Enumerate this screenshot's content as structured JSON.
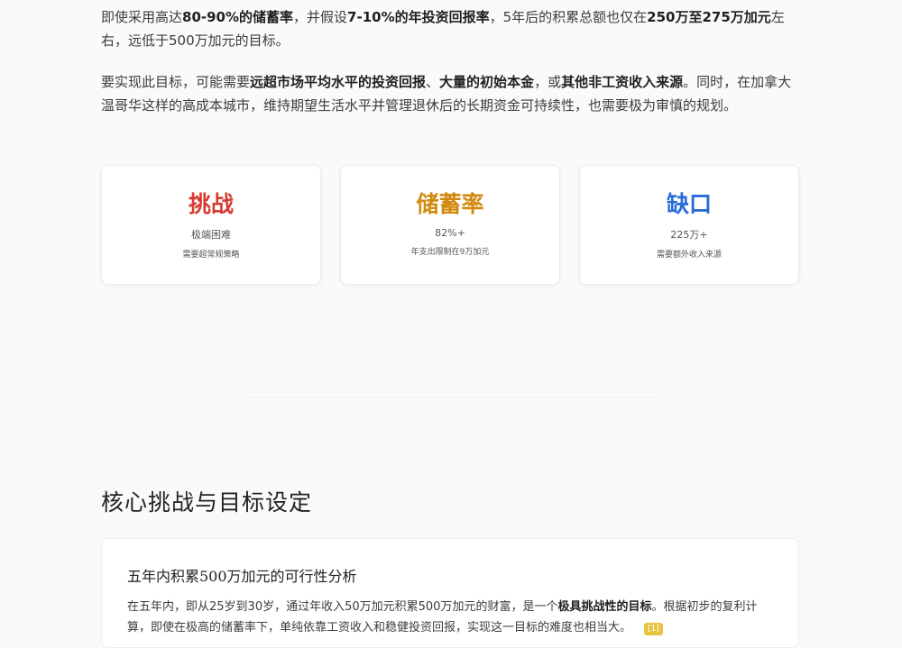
{
  "intro": {
    "p1": {
      "t1": "即使采用高达",
      "b1": "80-90%的储蓄率",
      "t2": "，并假设",
      "b2": "7-10%的年投资回报率",
      "t3": "，5年后的积累总额也仅在",
      "b3": "250万至275万加元",
      "t4": "左右，远低于500万加元的目标。"
    },
    "p2": {
      "t1": "要实现此目标，可能需要",
      "b1": "远超市场平均水平的投资回报",
      "t2": "、",
      "b2": "大量的初始本金",
      "t3": "，或",
      "b3": "其他非工资收入来源",
      "t4": "。同时，在加拿大温哥华这样的高成本城市，维持期望生活水平并管理退休后的长期资金可持续性，也需要极为审慎的规划。"
    }
  },
  "cards": [
    {
      "title": "挑战",
      "sub": "极端困难",
      "note": "需要超常规策略",
      "color": "#d63b30"
    },
    {
      "title": "储蓄率",
      "sub": "82%+",
      "note": "年支出限制在9万加元",
      "color": "#d18a0f"
    },
    {
      "title": "缺口",
      "sub": "225万+",
      "note": "需要额外收入来源",
      "color": "#2a6bd6"
    }
  ],
  "section": {
    "title": "核心挑战与目标设定",
    "panel_title": "五年内积累500万加元的可行性分析",
    "text": {
      "t1": "在五年内，即从25岁到30岁，通过年收入50万加元积累500万加元的财富，是一个",
      "b1": "极具挑战性的目标",
      "t2": "。根据初步的复利计算，即使在极高的储蓄率下，单纯依靠工资收入和稳健投资回报，实现这一目标的难度也相当大。",
      "cite": "[1]"
    }
  }
}
